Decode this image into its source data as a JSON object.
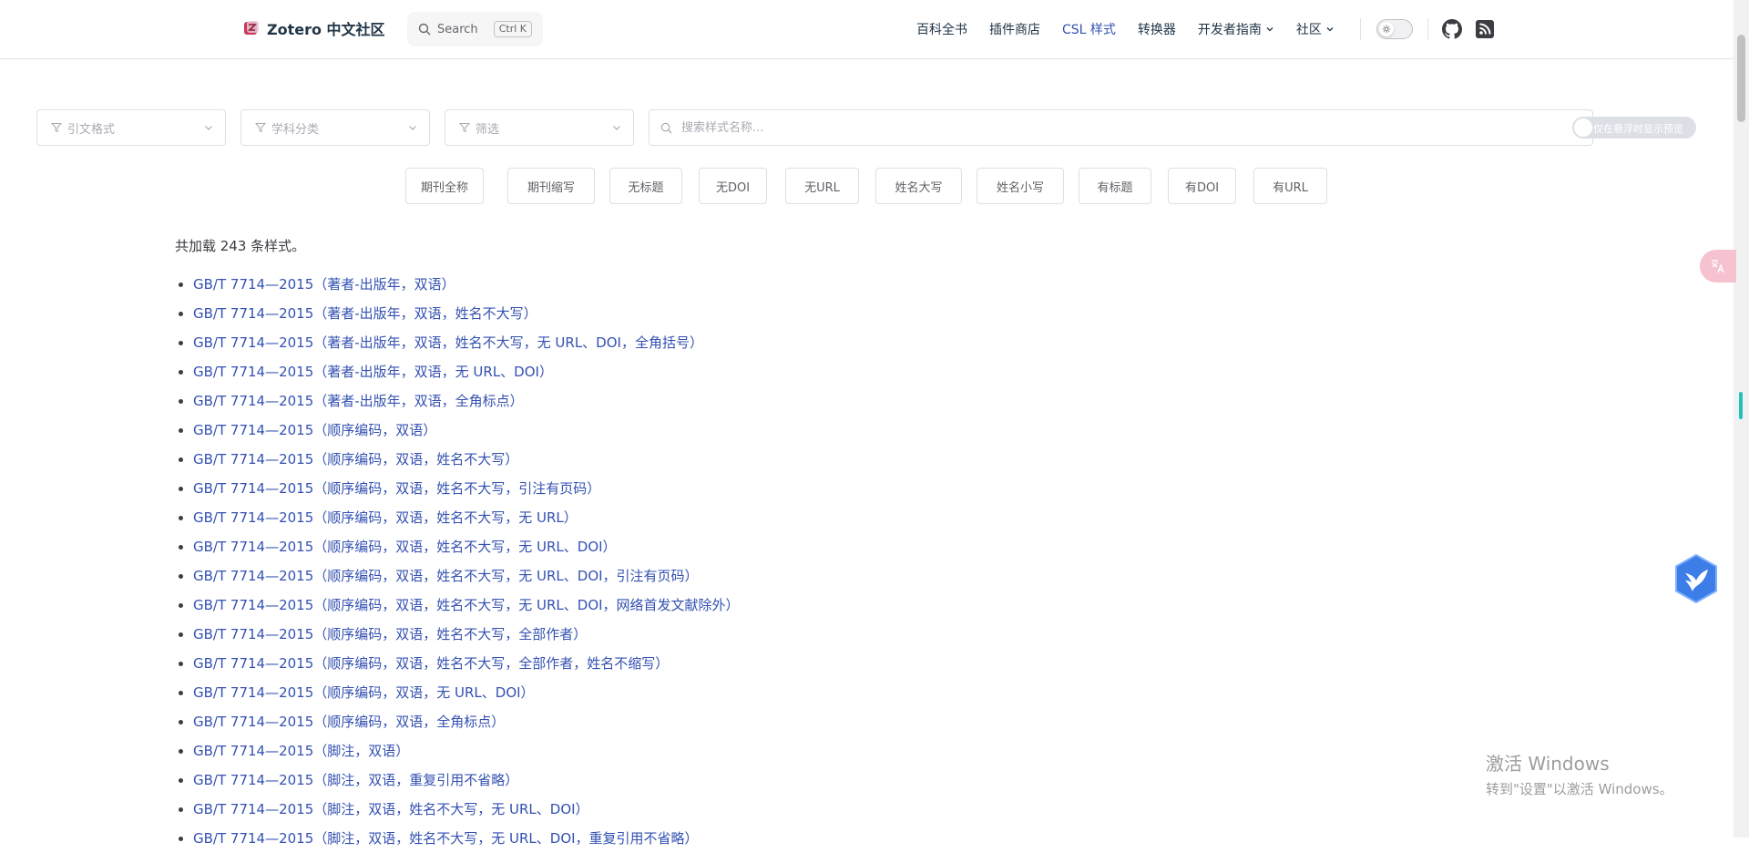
{
  "navbar": {
    "title": "Zotero 中文社区",
    "search_label": "Search",
    "search_shortcut": "Ctrl K",
    "links": [
      {
        "label": "百科全书",
        "active": false,
        "dropdown": false
      },
      {
        "label": "插件商店",
        "active": false,
        "dropdown": false
      },
      {
        "label": "CSL 样式",
        "active": true,
        "dropdown": false
      },
      {
        "label": "转换器",
        "active": false,
        "dropdown": false
      },
      {
        "label": "开发者指南",
        "active": false,
        "dropdown": true
      },
      {
        "label": "社区",
        "active": false,
        "dropdown": true
      }
    ],
    "theme_toggle_icon": "sun-icon",
    "social_icons": [
      "github-icon",
      "rss-icon"
    ]
  },
  "filters": {
    "citation_format_placeholder": "引文格式",
    "subject_placeholder": "学科分类",
    "filter_placeholder": "筛选",
    "search_placeholder": "搜索样式名称...",
    "preview_switch_label": "仅在悬浮时显示预览",
    "preview_switch_on": false
  },
  "tags": [
    "期刊全称",
    "期刊缩写",
    "无标题",
    "无DOI",
    "无URL",
    "姓名大写",
    "姓名小写",
    "有标题",
    "有DOI",
    "有URL"
  ],
  "summary": "共加载 243 条样式。",
  "styles": [
    "GB/T 7714—2015（著者-出版年，双语）",
    "GB/T 7714—2015（著者-出版年，双语，姓名不大写）",
    "GB/T 7714—2015（著者-出版年，双语，姓名不大写，无 URL、DOI，全角括号）",
    "GB/T 7714—2015（著者-出版年，双语，无 URL、DOI）",
    "GB/T 7714—2015（著者-出版年，双语，全角标点）",
    "GB/T 7714—2015（顺序编码，双语）",
    "GB/T 7714—2015（顺序编码，双语，姓名不大写）",
    "GB/T 7714—2015（顺序编码，双语，姓名不大写，引注有页码）",
    "GB/T 7714—2015（顺序编码，双语，姓名不大写，无 URL）",
    "GB/T 7714—2015（顺序编码，双语，姓名不大写，无 URL、DOI）",
    "GB/T 7714—2015（顺序编码，双语，姓名不大写，无 URL、DOI，引注有页码）",
    "GB/T 7714—2015（顺序编码，双语，姓名不大写，无 URL、DOI，网络首发文献除外）",
    "GB/T 7714—2015（顺序编码，双语，姓名不大写，全部作者）",
    "GB/T 7714—2015（顺序编码，双语，姓名不大写，全部作者，姓名不缩写）",
    "GB/T 7714—2015（顺序编码，双语，无 URL、DOI）",
    "GB/T 7714—2015（顺序编码，双语，全角标点）",
    "GB/T 7714—2015（脚注，双语）",
    "GB/T 7714—2015（脚注，双语，重复引用不省略）",
    "GB/T 7714—2015（脚注，双语，姓名不大写，无 URL、DOI）",
    "GB/T 7714—2015（脚注，双语，姓名不大写，无 URL、DOI，重复引用不省略）"
  ],
  "watermark": {
    "line1": "激活 Windows",
    "line2": "转到\"设置\"以激活 Windows。"
  },
  "colors": {
    "link": "#3451b2",
    "accent_scroll_marker": "#23c0c0",
    "translate_button": "#f7c2cf"
  }
}
